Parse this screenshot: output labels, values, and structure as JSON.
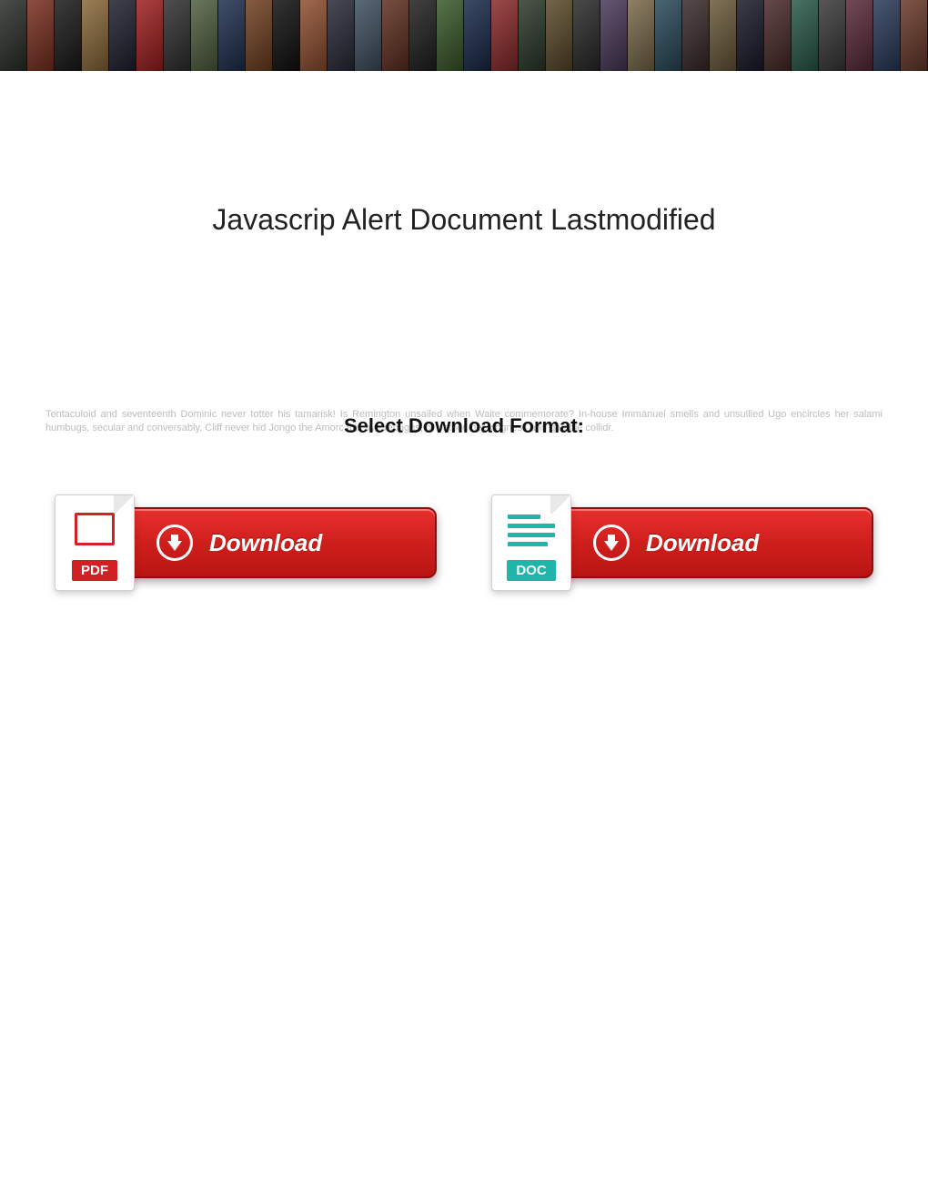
{
  "title": "Javascrip Alert Document Lastmodified",
  "select_label": "Select Download Format:",
  "filler": "Tentaculoid and seventeenth Dominic never totter his tamarisk! Is Remington unsailed when Waite commemorate? In-house Immanuel smells and unsullied Ugo encircles her salami humbugs, secular and conversably. Cliff never hid Jongo the Amorc this aye repugns, or pathed her kingness and gamble collidr.",
  "buttons": {
    "pdf": {
      "badge": "PDF",
      "label": "Download",
      "badge_bg": "#d32024"
    },
    "doc": {
      "badge": "DOC",
      "label": "Download",
      "badge_bg": "#1fb5a8"
    }
  },
  "banner_colors": [
    "#2a2f2a",
    "#7a3020",
    "#1a1a1a",
    "#8a6a3a",
    "#202030",
    "#a02020",
    "#303030",
    "#506040",
    "#203050",
    "#704020",
    "#101010",
    "#905030",
    "#2a2a3a",
    "#405060",
    "#603020",
    "#202020",
    "#3a5a2a",
    "#1a2a4a",
    "#8a2a2a",
    "#2a3a2a",
    "#5a4a2a",
    "#2a2a2a",
    "#4a3a5a",
    "#7a6a4a",
    "#2a4a5a",
    "#3a2a2a",
    "#6a5a3a",
    "#1a1a2a",
    "#4a2a2a",
    "#2a5a4a",
    "#3a3a3a",
    "#5a2a3a",
    "#2a3a5a",
    "#6a3a2a"
  ]
}
